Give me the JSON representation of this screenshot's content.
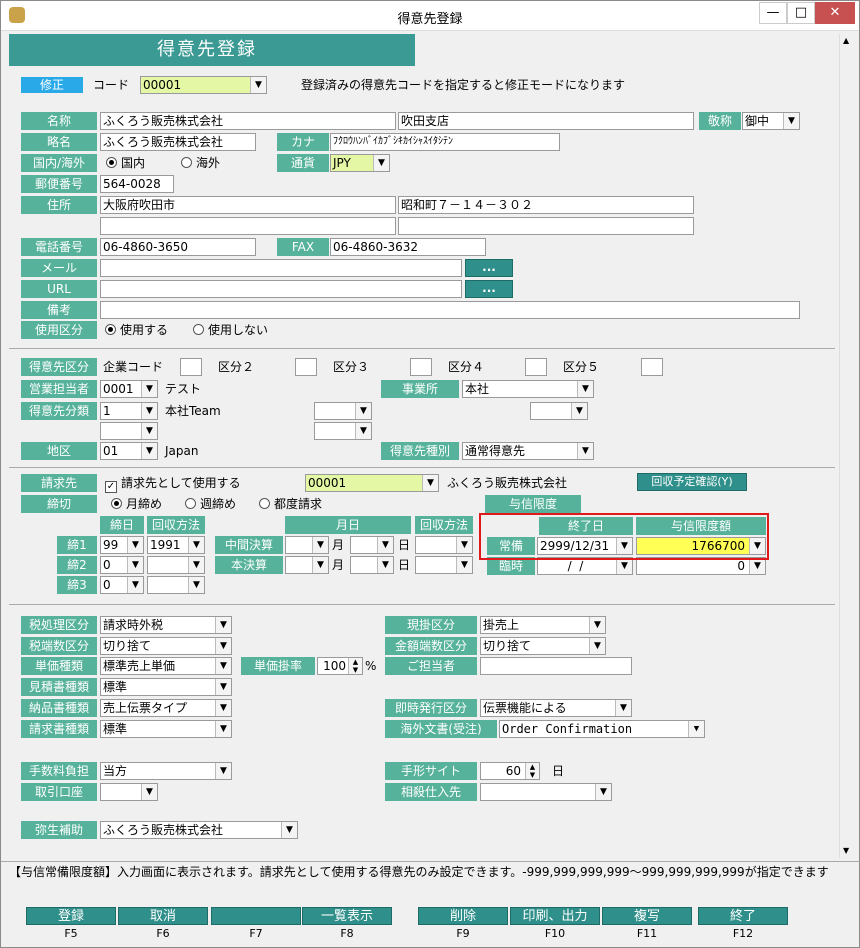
{
  "window": {
    "title": "得意先登録",
    "min": "—",
    "max": "□",
    "close": "✕"
  },
  "banner": "得意先登録",
  "mode": {
    "badge": "修正",
    "code_label": "コード",
    "code_value": "00001",
    "hint": "登録済みの得意先コードを指定すると修正モードになります"
  },
  "basic": {
    "name_label": "名称",
    "name_value": "ふくろう販売株式会社",
    "branch_value": "吹田支店",
    "honorific_label": "敬称",
    "honorific_value": "御中",
    "short_label": "略名",
    "short_value": "ふくろう販売株式会社",
    "kana_label": "カナ",
    "kana_value": "ﾌｸﾛｳﾊﾝﾊﾞｲｶﾌﾞｼｷｶｲｼｬｽｲﾀｼﾃﾝ",
    "domestic_label": "国内/海外",
    "domestic_opt": "国内",
    "overseas_opt": "海外",
    "currency_label": "通貨",
    "currency_value": "JPY",
    "zip_label": "郵便番号",
    "zip_value": "564-0028",
    "addr_label": "住所",
    "addr1": "大阪府吹田市",
    "addr2": "昭和町７－１４－３０２",
    "tel_label": "電話番号",
    "tel_value": "06-4860-3650",
    "fax_label": "FAX",
    "fax_value": "06-4860-3632",
    "mail_label": "メール",
    "url_label": "URL",
    "dots": "...",
    "note_label": "備考",
    "usage_label": "使用区分",
    "use_opt": "使用する",
    "nouse_opt": "使用しない"
  },
  "classes": {
    "kubun_label": "得意先区分",
    "corp_code": "企業コード",
    "k2": "区分２",
    "k3": "区分３",
    "k4": "区分４",
    "k5": "区分５",
    "sales_label": "営業担当者",
    "sales_code": "0001",
    "sales_name": "テスト",
    "office_label": "事業所",
    "office_value": "本社",
    "cat_label": "得意先分類",
    "cat_code": "1",
    "cat_name": "本社Team",
    "area_label": "地区",
    "area_code": "01",
    "area_name": "Japan",
    "type_label": "得意先種別",
    "type_value": "通常得意先"
  },
  "billing": {
    "bill_label": "請求先",
    "bill_check": "請求先として使用する",
    "bill_code": "00001",
    "bill_name": "ふくろう販売株式会社",
    "recv_btn": "回収予定確認(Y)",
    "close_label": "締切",
    "monthly": "月締め",
    "weekly": "週締め",
    "each": "都度請求",
    "credit_label": "与信限度",
    "col_day": "締日",
    "col_method": "回収方法",
    "col_md": "月日",
    "col_method2": "回収方法",
    "c1": "締1",
    "c2": "締2",
    "c3": "締3",
    "c1_day": "99",
    "c1_method": "1991",
    "c2_day": "0",
    "c3_day": "0",
    "mid_label": "中間決算",
    "final_label": "本決算",
    "month": "月",
    "day": "日",
    "end_col": "終了日",
    "limit_col": "与信限度額",
    "regular": "常備",
    "temp": "臨時",
    "regular_end": "2999/12/31",
    "regular_limit": "1766700",
    "temp_end": "  /  /",
    "temp_limit": "0"
  },
  "tax": {
    "tax_label": "税処理区分",
    "tax_value": "請求時外税",
    "round_label": "税端数区分",
    "round_value": "切り捨て",
    "price_label": "単価種類",
    "price_value": "標準売上単価",
    "rate_label": "単価掛率",
    "rate_value": "100",
    "pct": "%",
    "quote_label": "見積書種類",
    "quote_value": "標準",
    "deliv_label": "納品書種類",
    "deliv_value": "売上伝票タイプ",
    "inv_label": "請求書種類",
    "inv_value": "標準",
    "cash_label": "現掛区分",
    "cash_value": "掛売上",
    "amtround_label": "金額端数区分",
    "amtround_value": "切り捨て",
    "person_label": "ご担当者",
    "issue_label": "即時発行区分",
    "issue_value": "伝票機能による",
    "foreign_label": "海外文書(受注)",
    "foreign_value": "Order Confirmation"
  },
  "fees": {
    "fee_label": "手数料負担",
    "fee_value": "当方",
    "bank_label": "取引口座",
    "note_label": "手形サイト",
    "note_value": "60",
    "note_unit": "日",
    "offset_label": "相殺仕入先",
    "yayoi_label": "弥生補助",
    "yayoi_value": "ふくろう販売株式会社"
  },
  "status": "【与信常備限度額】入力画面に表示されます。請求先として使用する得意先のみ設定できます。-999,999,999,999～999,999,999,999が指定できます",
  "fkeys": [
    {
      "label": "登録",
      "key": "F5"
    },
    {
      "label": "取消",
      "key": "F6"
    },
    {
      "label": "",
      "key": "F7"
    },
    {
      "label": "一覧表示",
      "key": "F8"
    },
    {
      "label": "削除",
      "key": "F9"
    },
    {
      "label": "印刷、出力",
      "key": "F10"
    },
    {
      "label": "複写",
      "key": "F11"
    },
    {
      "label": "終了",
      "key": "F12"
    }
  ]
}
